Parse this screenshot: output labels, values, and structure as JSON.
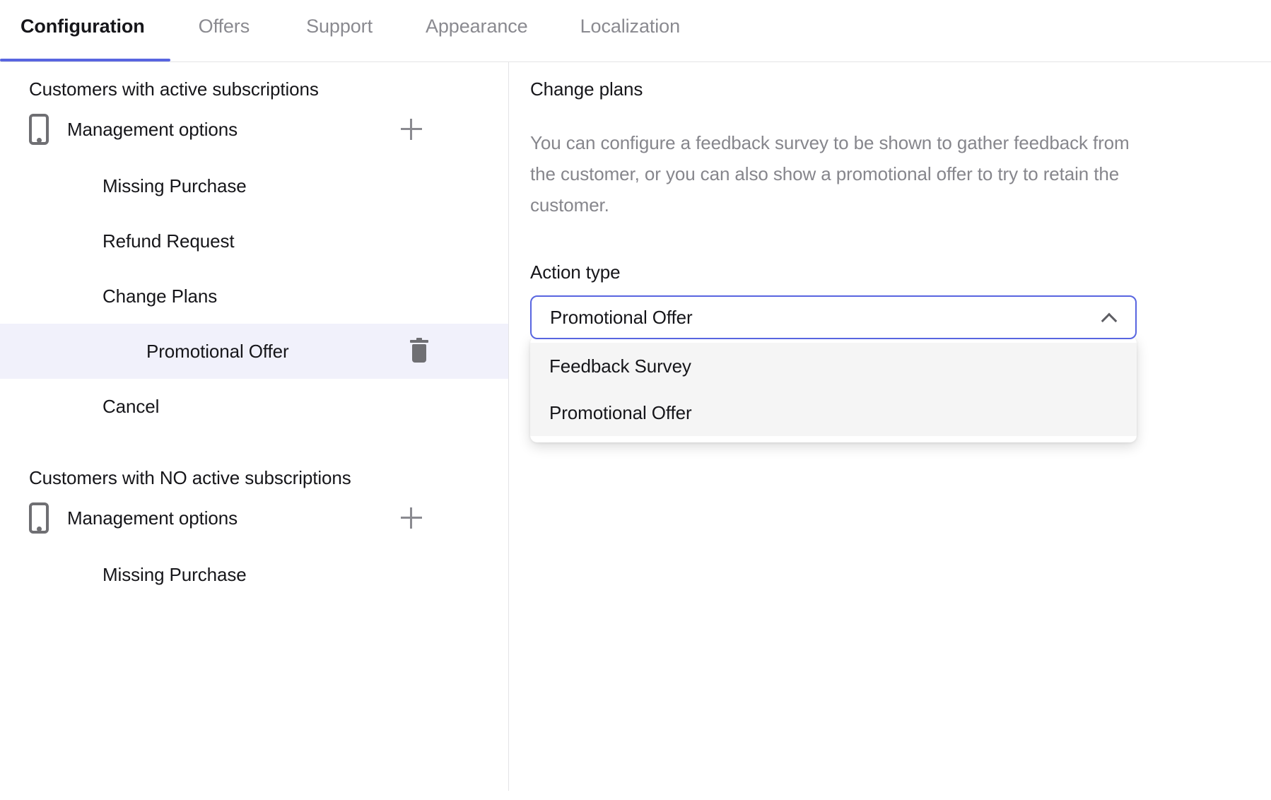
{
  "tabs": [
    {
      "label": "Configuration",
      "active": true
    },
    {
      "label": "Offers",
      "active": false
    },
    {
      "label": "Support",
      "active": false
    },
    {
      "label": "Appearance",
      "active": false
    },
    {
      "label": "Localization",
      "active": false
    }
  ],
  "sidebar": {
    "groups": [
      {
        "title": "Customers with active subscriptions",
        "items": [
          {
            "label": "Management options",
            "icon": "phone-icon",
            "action": "plus-icon",
            "indent": 0,
            "selected": false
          },
          {
            "label": "Missing Purchase",
            "icon": null,
            "action": null,
            "indent": 1,
            "selected": false
          },
          {
            "label": "Refund Request",
            "icon": null,
            "action": null,
            "indent": 1,
            "selected": false
          },
          {
            "label": "Change Plans",
            "icon": null,
            "action": null,
            "indent": 1,
            "selected": false
          },
          {
            "label": "Promotional Offer",
            "icon": null,
            "action": "trash-icon",
            "indent": 2,
            "selected": true
          },
          {
            "label": "Cancel",
            "icon": null,
            "action": null,
            "indent": 1,
            "selected": false
          }
        ]
      },
      {
        "title": "Customers with NO active subscriptions",
        "items": [
          {
            "label": "Management options",
            "icon": "phone-icon",
            "action": "plus-icon",
            "indent": 0,
            "selected": false
          },
          {
            "label": "Missing Purchase",
            "icon": null,
            "action": null,
            "indent": 1,
            "selected": false
          }
        ]
      }
    ]
  },
  "panel": {
    "title": "Change plans",
    "description": "You can configure a feedback survey to be shown to gather feedback from the customer, or you can also show a promotional offer to try to retain the customer.",
    "action_type": {
      "label": "Action type",
      "selected": "Promotional Offer",
      "expanded": true,
      "chevron": "chevron-up-icon",
      "options": [
        {
          "label": "Feedback Survey"
        },
        {
          "label": "Promotional Offer"
        }
      ]
    }
  },
  "colors": {
    "accent": "#5865e0",
    "selected_row_bg": "#f1f1fb",
    "dropdown_bg": "#f5f5f5",
    "muted_text": "#86868c",
    "icon_gray": "#6f6f73"
  }
}
